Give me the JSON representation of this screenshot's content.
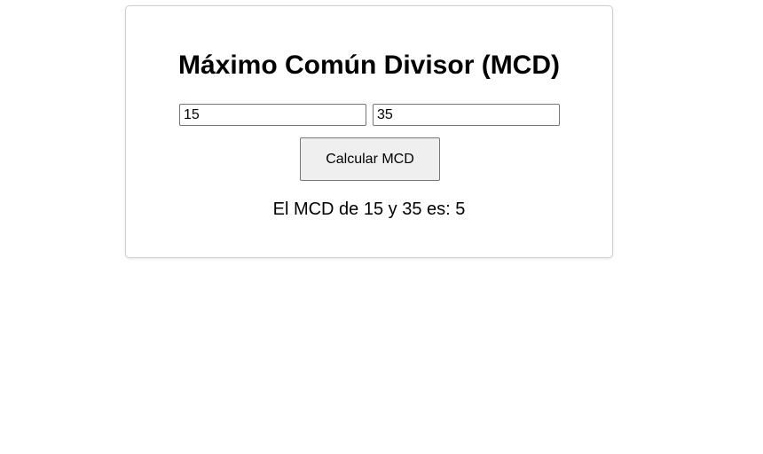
{
  "card": {
    "title": "Máximo Común Divisor (MCD)",
    "input_a": {
      "value": "15"
    },
    "input_b": {
      "value": "35"
    },
    "calculate_button_label": "Calcular MCD",
    "result_text": "El MCD de 15 y 35 es: 5"
  },
  "colors": {
    "page_background": "#ffffff",
    "card_border": "#cfcfcf",
    "button_background": "#efefef",
    "input_border": "#767676"
  }
}
